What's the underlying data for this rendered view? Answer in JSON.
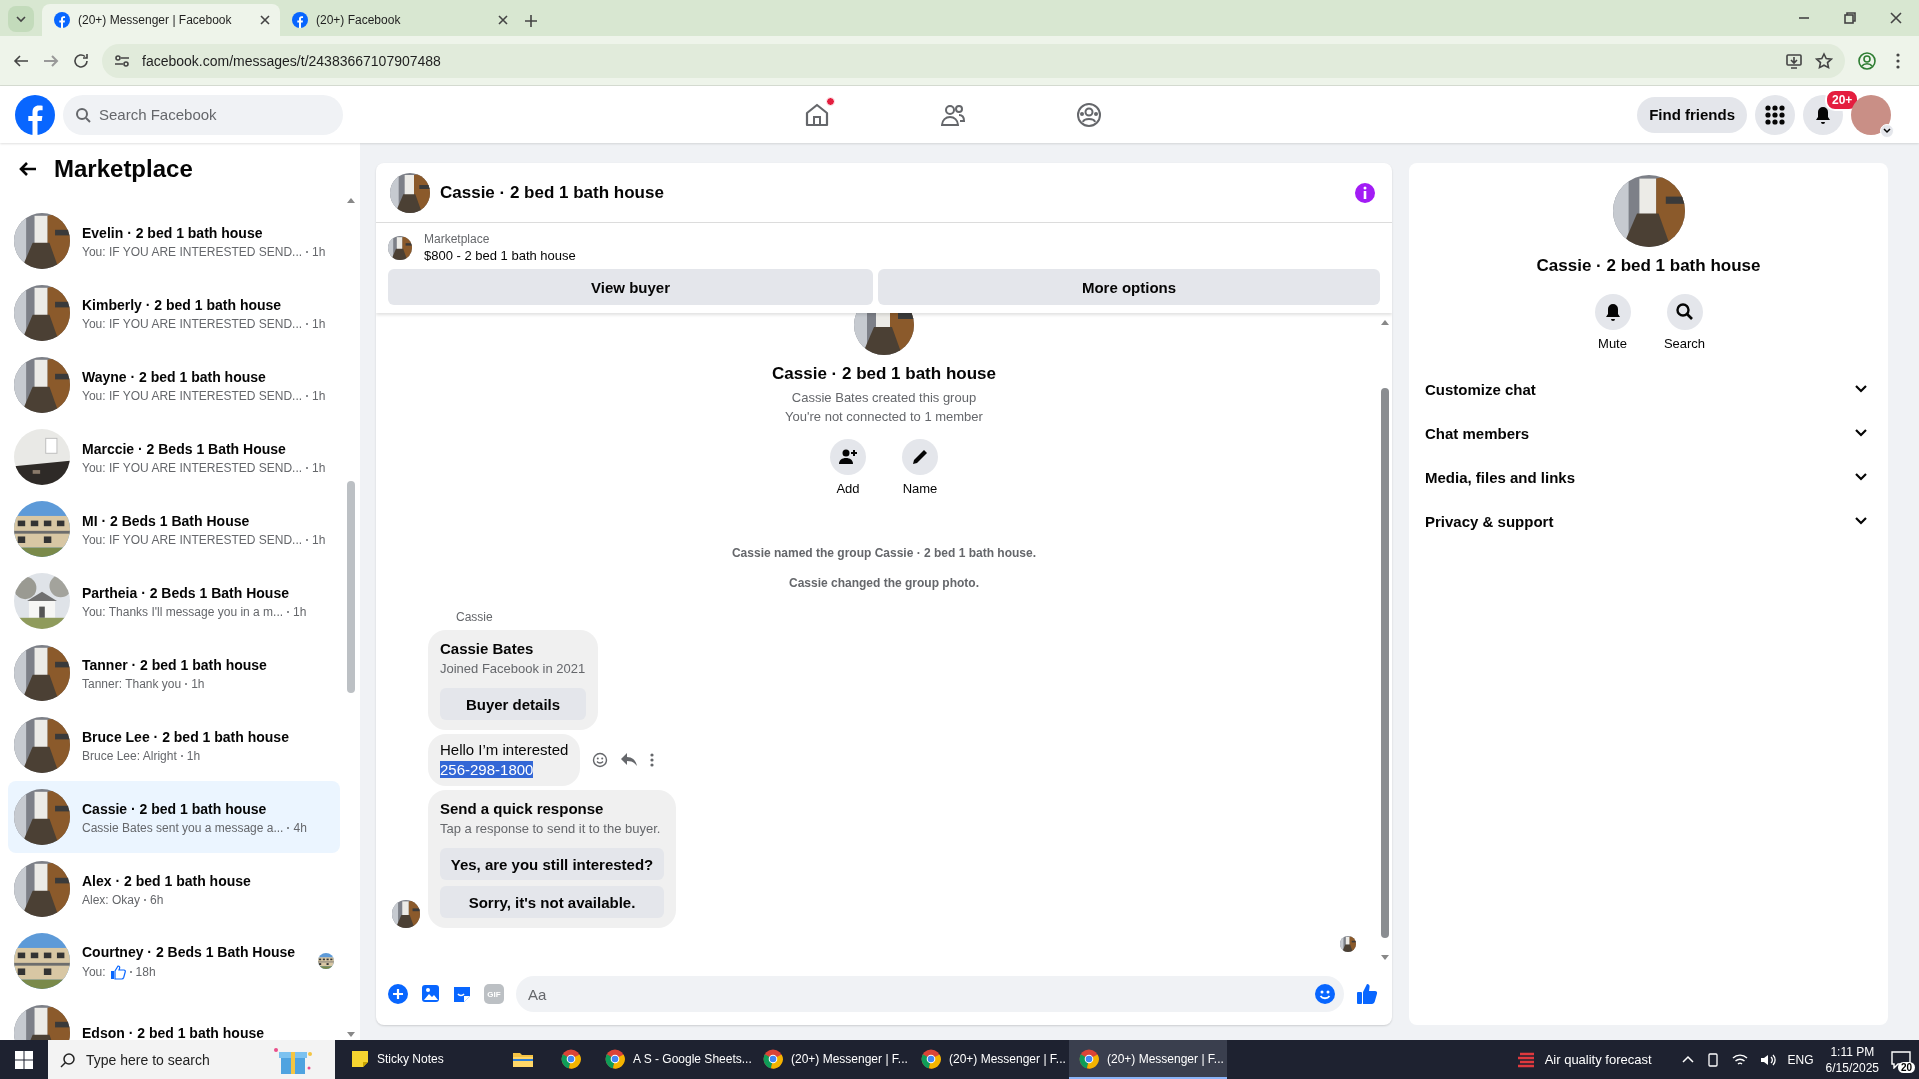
{
  "browser": {
    "tabs": [
      {
        "title": "(20+) Messenger | Facebook",
        "selected": true
      },
      {
        "title": "(20+) Facebook",
        "selected": false
      }
    ],
    "url": "facebook.com/messages/t/24383667107907488"
  },
  "header": {
    "search_placeholder": "Search Facebook",
    "nav": [
      {
        "kind": "home",
        "badge": true
      },
      {
        "kind": "friends",
        "badge": false
      },
      {
        "kind": "groups",
        "badge": false
      }
    ],
    "find_friends": "Find friends",
    "notification_count": "20+"
  },
  "sidebar": {
    "title": "Marketplace",
    "conversations": [
      {
        "name": "Evelin · 2 bed 1 bath house",
        "preview": "You: IF YOU ARE INTERESTED SEND...",
        "time": "1h",
        "kind": "text",
        "seen": false,
        "selected": false
      },
      {
        "name": "Kimberly · 2 bed 1 bath house",
        "preview": "You: IF YOU ARE INTERESTED SEND...",
        "time": "1h",
        "kind": "text",
        "seen": false,
        "selected": false
      },
      {
        "name": "Wayne · 2 bed 1 bath house",
        "preview": "You: IF YOU ARE INTERESTED SEND...",
        "time": "1h",
        "kind": "text",
        "seen": false,
        "selected": false
      },
      {
        "name": "Marccie · 2 Beds 1 Bath House",
        "preview": "You: IF YOU ARE INTERESTED SEND...",
        "time": "1h",
        "kind": "text",
        "seen": false,
        "selected": false
      },
      {
        "name": "MI · 2 Beds 1 Bath House",
        "preview": "You: IF YOU ARE INTERESTED SEND...",
        "time": "1h",
        "kind": "text",
        "seen": false,
        "selected": false
      },
      {
        "name": "Partheia · 2 Beds 1 Bath House",
        "preview": "You: Thanks I'll message you in a m...",
        "time": "1h",
        "kind": "text",
        "seen": false,
        "selected": false
      },
      {
        "name": "Tanner · 2 bed 1 bath house",
        "preview": "Tanner: Thank you",
        "time": "1h",
        "kind": "text",
        "seen": false,
        "selected": false
      },
      {
        "name": "Bruce Lee · 2 bed 1 bath house",
        "preview": "Bruce Lee: Alright",
        "time": "1h",
        "kind": "text",
        "seen": false,
        "selected": false
      },
      {
        "name": "Cassie · 2 bed 1 bath house",
        "preview": "Cassie Bates sent you a message a...",
        "time": "4h",
        "kind": "text",
        "seen": false,
        "selected": true
      },
      {
        "name": "Alex · 2 bed 1 bath house",
        "preview": "Alex: Okay",
        "time": "6h",
        "kind": "text",
        "seen": false,
        "selected": false
      },
      {
        "name": "Courtney · 2 Beds 1 Bath House",
        "preview": "You:",
        "time": "18h",
        "kind": "like",
        "seen": true,
        "selected": false
      },
      {
        "name": "Edson · 2 bed 1 bath house",
        "kind": "text",
        "seen": false,
        "selected": false
      }
    ]
  },
  "chat": {
    "title": "Cassie · 2 bed 1 bath house",
    "listing": {
      "label": "Marketplace",
      "title": "$800 - 2 bed 1 bath house"
    },
    "buttons": [
      "View buyer",
      "More options"
    ],
    "intro": {
      "title": "Cassie · 2 bed 1 bath house",
      "lines": [
        "Cassie Bates created this group",
        "You're not connected to 1 member"
      ],
      "actions": [
        {
          "kind": "add",
          "label": "Add"
        },
        {
          "kind": "name",
          "label": "Name"
        }
      ]
    },
    "events": [
      "Cassie named the group Cassie · 2 bed 1 bath house.",
      "Cassie changed the group photo."
    ],
    "sender": "Cassie",
    "buyer_card": {
      "name": "Cassie Bates",
      "subtitle": "Joined Facebook in 2021",
      "button": "Buyer details"
    },
    "message": [
      {
        "text": "Hello I’m interested",
        "selected": false
      },
      {
        "text": "256-298-1800",
        "selected": true
      }
    ],
    "quick_response": {
      "title": "Send a quick response",
      "subtitle": "Tap a response to send it to the buyer.",
      "options": [
        "Yes, are you still interested?",
        "Sorry, it's not available."
      ]
    },
    "composer": {
      "gif": "GIF",
      "placeholder": "Aa"
    }
  },
  "details": {
    "title": "Cassie · 2 bed 1 bath house",
    "actions": [
      {
        "kind": "mute",
        "label": "Mute"
      },
      {
        "kind": "search",
        "label": "Search"
      }
    ],
    "sections": [
      {
        "label": "Customize chat",
        "expanded": false
      },
      {
        "label": "Chat members",
        "expanded": false
      },
      {
        "label": "Media, files and links",
        "expanded": false
      },
      {
        "label": "Privacy & support",
        "expanded": false
      }
    ]
  },
  "taskbar": {
    "search_placeholder": "Type here to search",
    "apps": [
      {
        "kind": "sticky",
        "label": "Sticky Notes",
        "selected": false
      },
      {
        "kind": "explorer",
        "selected": false
      },
      {
        "kind": "chrome",
        "selected": false
      },
      {
        "kind": "chrome",
        "label": "A S - Google Sheets...",
        "selected": false
      },
      {
        "kind": "chrome",
        "label": "(20+) Messenger | F...",
        "selected": false
      },
      {
        "kind": "chrome",
        "label": "(20+) Messenger | F...",
        "selected": false
      },
      {
        "kind": "chrome",
        "label": "(20+) Messenger | F...",
        "selected": true
      }
    ],
    "weather": "Air quality forecast",
    "language": "ENG",
    "time": "1:11 PM",
    "date": "6/15/2025",
    "notifications": "20"
  }
}
